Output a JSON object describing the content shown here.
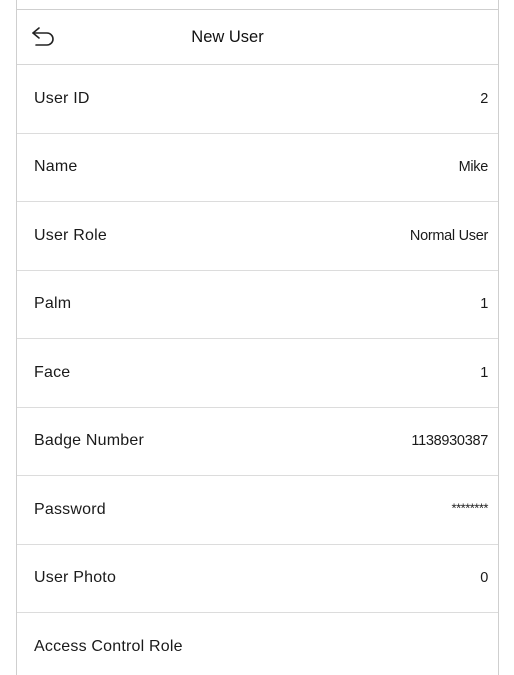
{
  "header": {
    "title": "New User",
    "back_icon": "back-arrow-icon"
  },
  "fields": [
    {
      "label": "User ID",
      "value": "2"
    },
    {
      "label": "Name",
      "value": "Mike"
    },
    {
      "label": "User Role",
      "value": "Normal User"
    },
    {
      "label": "Palm",
      "value": "1"
    },
    {
      "label": "Face",
      "value": "1"
    },
    {
      "label": "Badge Number",
      "value": "1138930387"
    },
    {
      "label": "Password",
      "value": "********"
    },
    {
      "label": "User Photo",
      "value": "0"
    },
    {
      "label": "Access Control Role",
      "value": ""
    }
  ]
}
